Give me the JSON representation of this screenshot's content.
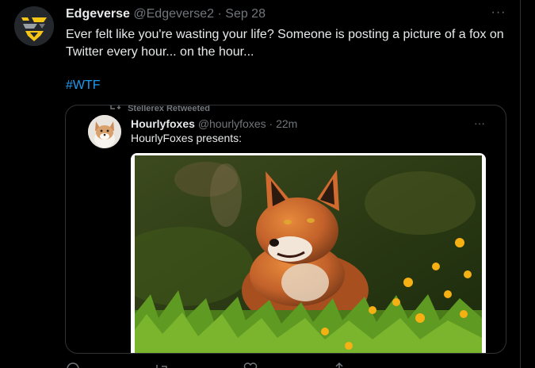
{
  "tweet": {
    "author_name": "Edgeverse",
    "author_handle": "@Edgeverse2",
    "separator": "·",
    "timestamp": "Sep 28",
    "more_label": "···",
    "text": "Ever felt like you're wasting your life? Someone is posting a picture of a fox on Twitter every hour... on the hour...",
    "hashtag": "#WTF",
    "avatar_icon": "edgeverse-logo-icon"
  },
  "quoted": {
    "retweet_icon": "retweet-icon",
    "retweet_label": "Stellerex Retweeted",
    "author_name": "Hourlyfoxes",
    "author_handle": "@hourlyfoxes",
    "separator": "·",
    "timestamp": "22m",
    "more_label": "···",
    "text": "HourlyFoxes presents:",
    "image_subject": "red fox in grass with yellow flowers"
  },
  "actions": [
    "reply-icon",
    "retweet-icon",
    "like-icon",
    "share-icon"
  ],
  "colors": {
    "background": "#000000",
    "text_primary": "#e7e9ea",
    "text_secondary": "#71767b",
    "link": "#1d9bf0",
    "border": "#2f3336",
    "logo_yellow": "#f5c518"
  }
}
